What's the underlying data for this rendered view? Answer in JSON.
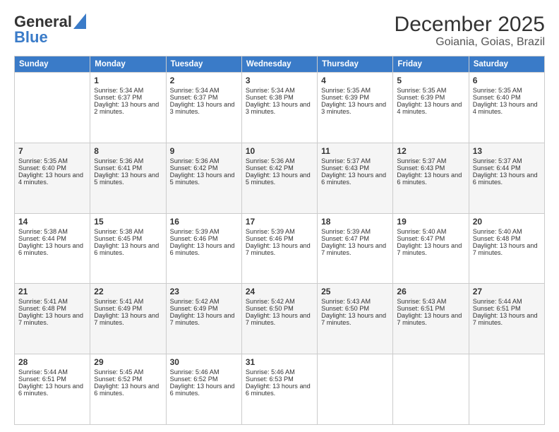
{
  "logo": {
    "line1": "General",
    "line2": "Blue"
  },
  "title": "December 2025",
  "subtitle": "Goiania, Goias, Brazil",
  "days_header": [
    "Sunday",
    "Monday",
    "Tuesday",
    "Wednesday",
    "Thursday",
    "Friday",
    "Saturday"
  ],
  "weeks": [
    [
      {
        "day": "",
        "sunrise": "",
        "sunset": "",
        "daylight": ""
      },
      {
        "day": "1",
        "sunrise": "Sunrise: 5:34 AM",
        "sunset": "Sunset: 6:37 PM",
        "daylight": "Daylight: 13 hours and 2 minutes."
      },
      {
        "day": "2",
        "sunrise": "Sunrise: 5:34 AM",
        "sunset": "Sunset: 6:37 PM",
        "daylight": "Daylight: 13 hours and 3 minutes."
      },
      {
        "day": "3",
        "sunrise": "Sunrise: 5:34 AM",
        "sunset": "Sunset: 6:38 PM",
        "daylight": "Daylight: 13 hours and 3 minutes."
      },
      {
        "day": "4",
        "sunrise": "Sunrise: 5:35 AM",
        "sunset": "Sunset: 6:39 PM",
        "daylight": "Daylight: 13 hours and 3 minutes."
      },
      {
        "day": "5",
        "sunrise": "Sunrise: 5:35 AM",
        "sunset": "Sunset: 6:39 PM",
        "daylight": "Daylight: 13 hours and 4 minutes."
      },
      {
        "day": "6",
        "sunrise": "Sunrise: 5:35 AM",
        "sunset": "Sunset: 6:40 PM",
        "daylight": "Daylight: 13 hours and 4 minutes."
      }
    ],
    [
      {
        "day": "7",
        "sunrise": "Sunrise: 5:35 AM",
        "sunset": "Sunset: 6:40 PM",
        "daylight": "Daylight: 13 hours and 4 minutes."
      },
      {
        "day": "8",
        "sunrise": "Sunrise: 5:36 AM",
        "sunset": "Sunset: 6:41 PM",
        "daylight": "Daylight: 13 hours and 5 minutes."
      },
      {
        "day": "9",
        "sunrise": "Sunrise: 5:36 AM",
        "sunset": "Sunset: 6:42 PM",
        "daylight": "Daylight: 13 hours and 5 minutes."
      },
      {
        "day": "10",
        "sunrise": "Sunrise: 5:36 AM",
        "sunset": "Sunset: 6:42 PM",
        "daylight": "Daylight: 13 hours and 5 minutes."
      },
      {
        "day": "11",
        "sunrise": "Sunrise: 5:37 AM",
        "sunset": "Sunset: 6:43 PM",
        "daylight": "Daylight: 13 hours and 6 minutes."
      },
      {
        "day": "12",
        "sunrise": "Sunrise: 5:37 AM",
        "sunset": "Sunset: 6:43 PM",
        "daylight": "Daylight: 13 hours and 6 minutes."
      },
      {
        "day": "13",
        "sunrise": "Sunrise: 5:37 AM",
        "sunset": "Sunset: 6:44 PM",
        "daylight": "Daylight: 13 hours and 6 minutes."
      }
    ],
    [
      {
        "day": "14",
        "sunrise": "Sunrise: 5:38 AM",
        "sunset": "Sunset: 6:44 PM",
        "daylight": "Daylight: 13 hours and 6 minutes."
      },
      {
        "day": "15",
        "sunrise": "Sunrise: 5:38 AM",
        "sunset": "Sunset: 6:45 PM",
        "daylight": "Daylight: 13 hours and 6 minutes."
      },
      {
        "day": "16",
        "sunrise": "Sunrise: 5:39 AM",
        "sunset": "Sunset: 6:46 PM",
        "daylight": "Daylight: 13 hours and 6 minutes."
      },
      {
        "day": "17",
        "sunrise": "Sunrise: 5:39 AM",
        "sunset": "Sunset: 6:46 PM",
        "daylight": "Daylight: 13 hours and 7 minutes."
      },
      {
        "day": "18",
        "sunrise": "Sunrise: 5:39 AM",
        "sunset": "Sunset: 6:47 PM",
        "daylight": "Daylight: 13 hours and 7 minutes."
      },
      {
        "day": "19",
        "sunrise": "Sunrise: 5:40 AM",
        "sunset": "Sunset: 6:47 PM",
        "daylight": "Daylight: 13 hours and 7 minutes."
      },
      {
        "day": "20",
        "sunrise": "Sunrise: 5:40 AM",
        "sunset": "Sunset: 6:48 PM",
        "daylight": "Daylight: 13 hours and 7 minutes."
      }
    ],
    [
      {
        "day": "21",
        "sunrise": "Sunrise: 5:41 AM",
        "sunset": "Sunset: 6:48 PM",
        "daylight": "Daylight: 13 hours and 7 minutes."
      },
      {
        "day": "22",
        "sunrise": "Sunrise: 5:41 AM",
        "sunset": "Sunset: 6:49 PM",
        "daylight": "Daylight: 13 hours and 7 minutes."
      },
      {
        "day": "23",
        "sunrise": "Sunrise: 5:42 AM",
        "sunset": "Sunset: 6:49 PM",
        "daylight": "Daylight: 13 hours and 7 minutes."
      },
      {
        "day": "24",
        "sunrise": "Sunrise: 5:42 AM",
        "sunset": "Sunset: 6:50 PM",
        "daylight": "Daylight: 13 hours and 7 minutes."
      },
      {
        "day": "25",
        "sunrise": "Sunrise: 5:43 AM",
        "sunset": "Sunset: 6:50 PM",
        "daylight": "Daylight: 13 hours and 7 minutes."
      },
      {
        "day": "26",
        "sunrise": "Sunrise: 5:43 AM",
        "sunset": "Sunset: 6:51 PM",
        "daylight": "Daylight: 13 hours and 7 minutes."
      },
      {
        "day": "27",
        "sunrise": "Sunrise: 5:44 AM",
        "sunset": "Sunset: 6:51 PM",
        "daylight": "Daylight: 13 hours and 7 minutes."
      }
    ],
    [
      {
        "day": "28",
        "sunrise": "Sunrise: 5:44 AM",
        "sunset": "Sunset: 6:51 PM",
        "daylight": "Daylight: 13 hours and 6 minutes."
      },
      {
        "day": "29",
        "sunrise": "Sunrise: 5:45 AM",
        "sunset": "Sunset: 6:52 PM",
        "daylight": "Daylight: 13 hours and 6 minutes."
      },
      {
        "day": "30",
        "sunrise": "Sunrise: 5:46 AM",
        "sunset": "Sunset: 6:52 PM",
        "daylight": "Daylight: 13 hours and 6 minutes."
      },
      {
        "day": "31",
        "sunrise": "Sunrise: 5:46 AM",
        "sunset": "Sunset: 6:53 PM",
        "daylight": "Daylight: 13 hours and 6 minutes."
      },
      {
        "day": "",
        "sunrise": "",
        "sunset": "",
        "daylight": ""
      },
      {
        "day": "",
        "sunrise": "",
        "sunset": "",
        "daylight": ""
      },
      {
        "day": "",
        "sunrise": "",
        "sunset": "",
        "daylight": ""
      }
    ]
  ]
}
